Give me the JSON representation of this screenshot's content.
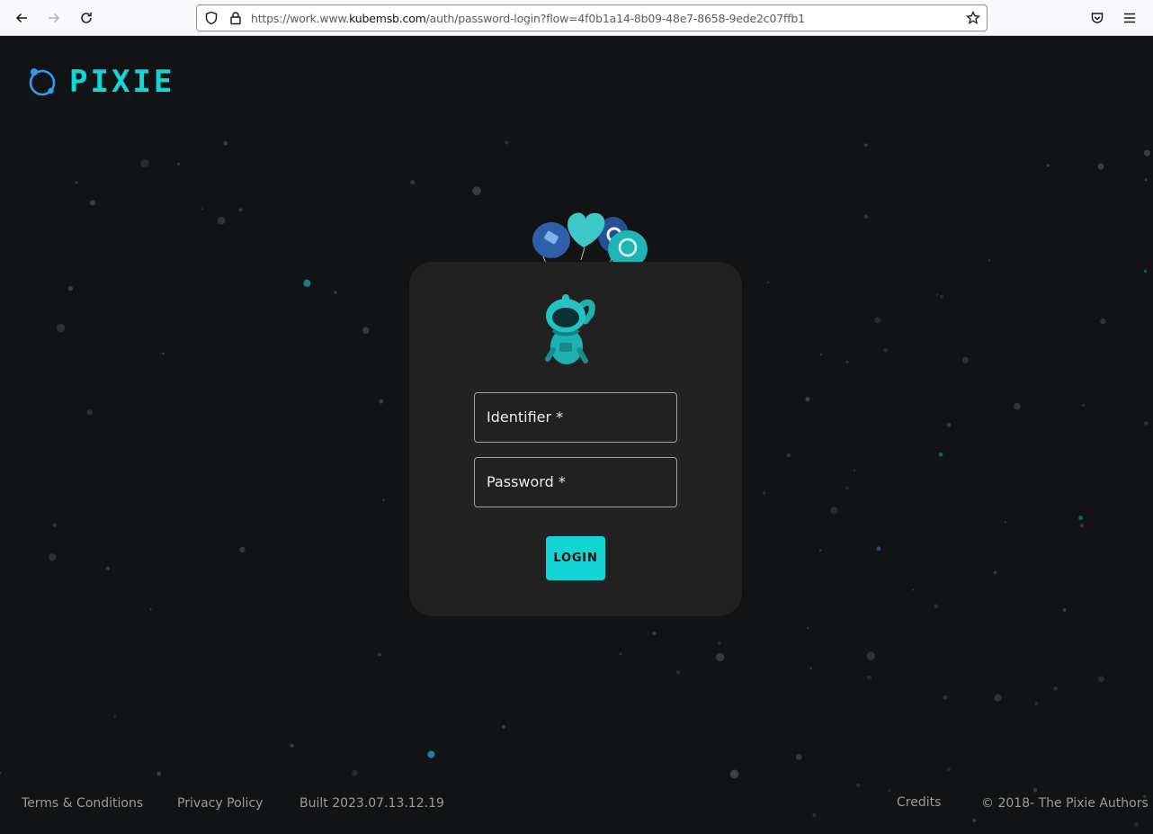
{
  "browser": {
    "url_prefix": "https://work.www.",
    "url_host": "kubemsb.com",
    "url_path": "/auth/password-login?flow=4f0b1a14-8b09-48e7-8658-9ede2c07ffb1"
  },
  "brand": {
    "name": "PIXIE",
    "accent_color": "#12d6d6"
  },
  "login_form": {
    "identifier_label": "Identifier *",
    "password_label": "Password *",
    "login_button": "LOGIN"
  },
  "footer": {
    "terms": "Terms & Conditions",
    "privacy": "Privacy Policy",
    "build": "Built 2023.07.13.12.19",
    "credits": "Credits",
    "copyright": "© 2018- The Pixie Authors"
  }
}
